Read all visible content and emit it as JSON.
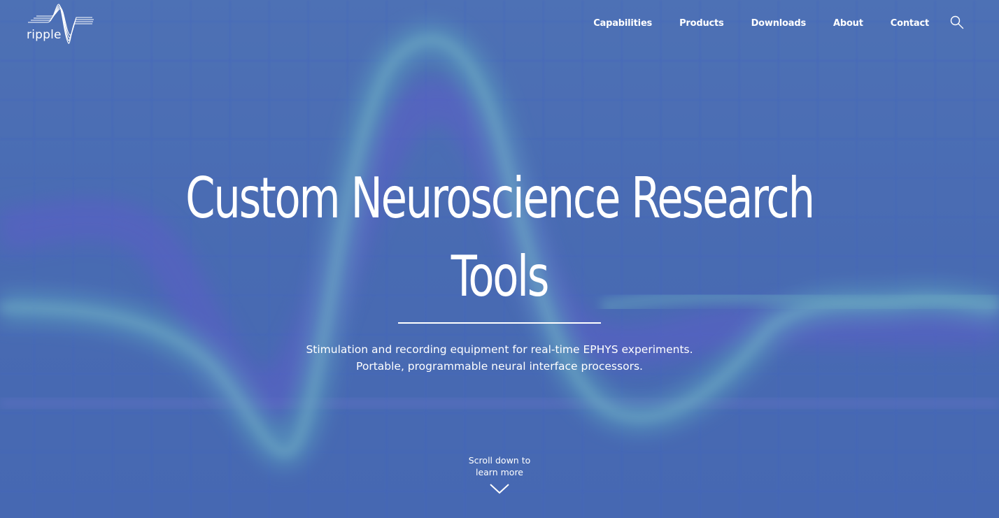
{
  "header": {
    "logo_text": "ripple",
    "nav": [
      {
        "label": "Capabilities"
      },
      {
        "label": "Products"
      },
      {
        "label": "Downloads"
      },
      {
        "label": "About"
      },
      {
        "label": "Contact"
      }
    ],
    "search_icon": "search-icon"
  },
  "hero": {
    "headline_line1": "Custom Neuroscience Research",
    "headline_line2": "Tools",
    "subtitle_line1": "Stimulation and recording equipment for real-time EPHYS experiments.",
    "subtitle_line2": "Portable, programmable neural interface processors.",
    "scroll_line1": "Scroll down to",
    "scroll_line2": "learn more",
    "scroll_icon": "chevron-down-icon"
  },
  "colors": {
    "background": "#4a6db0",
    "grid": "#3a5fc8",
    "trace_teal": "#6fc0c4",
    "trace_purple": "#6a5bd0",
    "text": "#ffffff"
  }
}
